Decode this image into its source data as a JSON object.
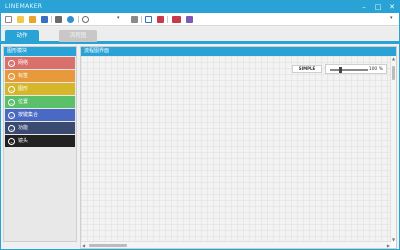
{
  "window": {
    "title": "LINEMAKER",
    "controls": {
      "minimize": "–",
      "maximize": "□",
      "close": "✕"
    }
  },
  "toolbar": {
    "icons": [
      {
        "name": "new-file-icon",
        "color": "#ffffff"
      },
      {
        "name": "new-doc-icon",
        "color": "#f2c94c"
      },
      {
        "name": "open-folder-icon",
        "color": "#e8a52c"
      },
      {
        "name": "save-icon",
        "color": "#3a6fc4"
      },
      {
        "name": "print-icon",
        "color": "#6b6b6b"
      },
      {
        "name": "globe-icon",
        "color": "#2e8fd1"
      },
      {
        "name": "search-icon",
        "color": "#6b6b6b"
      },
      {
        "name": "link-icon",
        "color": "#6b6b6b"
      },
      {
        "name": "document-icon",
        "color": "#3a6fc4"
      },
      {
        "name": "image-icon",
        "color": "#c8394a"
      },
      {
        "name": "presentation-icon",
        "color": "#c8394a"
      },
      {
        "name": "settings-icon",
        "color": "#7d5ab8"
      }
    ]
  },
  "tabs": [
    {
      "label": "动作",
      "active": true
    },
    {
      "label": "流程图",
      "active": false
    }
  ],
  "sidebar": {
    "header": "图形模块",
    "categories": [
      {
        "label": "网络",
        "color": "#d9706b"
      },
      {
        "label": "标签",
        "color": "#e79a3c"
      },
      {
        "label": "图形",
        "color": "#d6b62a"
      },
      {
        "label": "位置",
        "color": "#5cbf6a"
      },
      {
        "label": "按键集合",
        "color": "#4a69c2"
      },
      {
        "label": "功能",
        "color": "#3b4a70"
      },
      {
        "label": "镜头",
        "color": "#222222"
      }
    ]
  },
  "main": {
    "header": "流程图界面",
    "simple_label": "SIMPLE",
    "zoom": {
      "value": "100 %"
    }
  },
  "accent_color": "#29a3d6"
}
